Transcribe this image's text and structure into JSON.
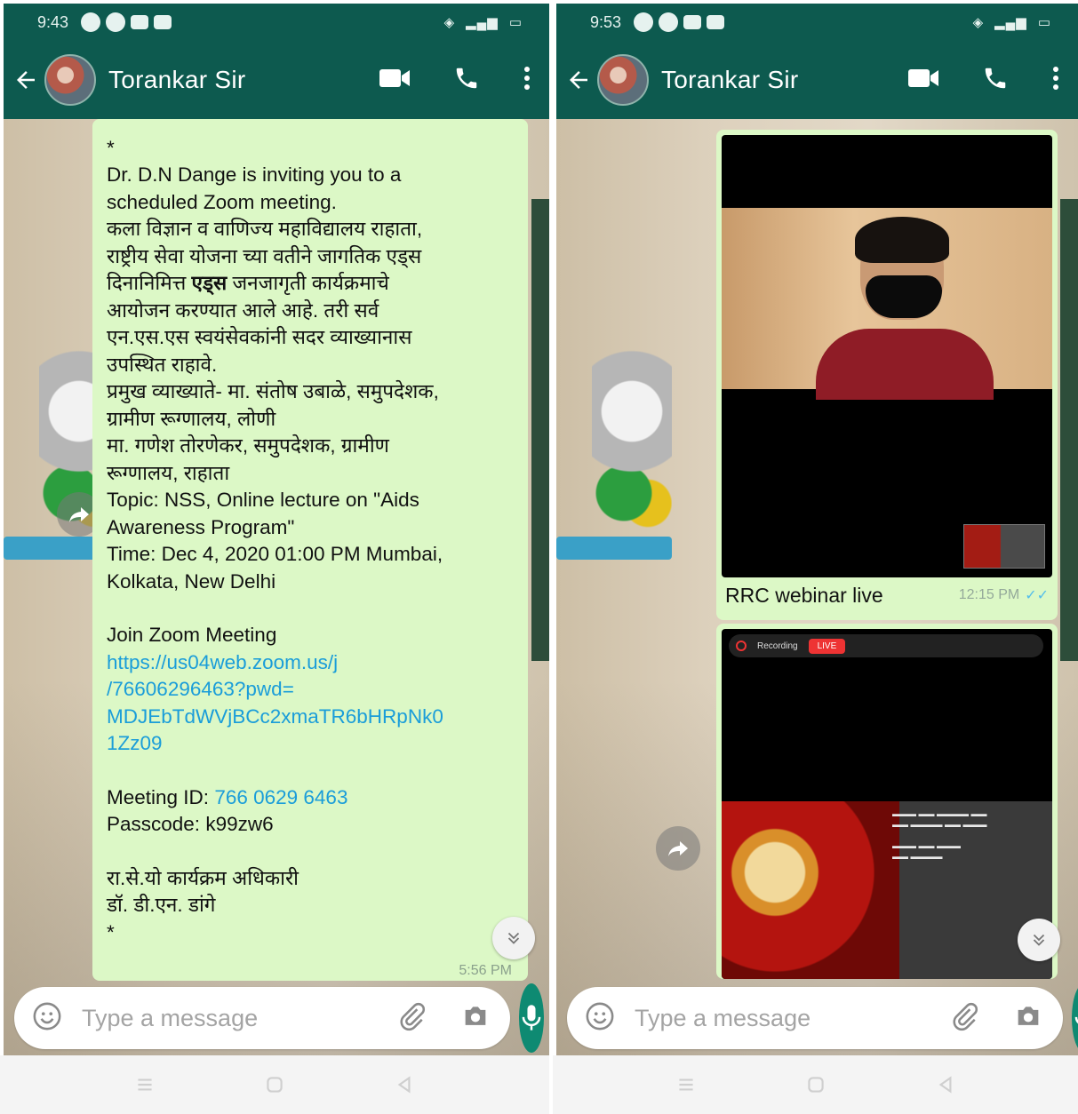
{
  "left": {
    "status": {
      "time": "9:43"
    },
    "header": {
      "name": "Torankar Sir"
    },
    "message": {
      "star_top": "*",
      "lines": [
        "Dr. D.N Dange is inviting you to a",
        "scheduled Zoom meeting.",
        "कला विज्ञान व वाणिज्य महाविद्यालय राहाता,",
        "राष्ट्रीय सेवा योजना च्या वतीने जागतिक एड्स",
        "दिनानिमित्त",
        "एड्स",
        "जनजागृती कार्यक्रमाचे",
        "आयोजन करण्यात आले आहे. तरी सर्व",
        "एन.एस.एस स्वयंसेवकांनी सदर व्याख्यानास",
        "उपस्थित राहावे.",
        "प्रमुख व्याख्याते- मा. संतोष उबाळे, समुपदेशक,",
        "ग्रामीण रूग्णालय, लोणी",
        "मा. गणेश तोरणेकर, समुपदेशक, ग्रामीण",
        "रूग्णालय,  राहाता",
        "Topic: NSS,  Online lecture on \"Aids",
        "Awareness Program\"",
        "Time: Dec 4, 2020 01:00 PM Mumbai,",
        "Kolkata, New Delhi"
      ],
      "join_label": "Join Zoom Meeting",
      "link_lines": [
        "https://us04web.zoom.us/j",
        "/76606296463?pwd=",
        "MDJEbTdWVjBCc2xmaTR6bHRpNk0",
        "1Zz09"
      ],
      "meeting_id_label": "Meeting ID: ",
      "meeting_id": "766 0629 6463",
      "passcode": "Passcode: k99zw6",
      "sign_1": "रा.से.यो कार्यक्रम अधिकारी",
      "sign_2": "डॉ. डी.एन. डांगे",
      "star_bottom": "*",
      "time": "5:56 PM"
    },
    "input": {
      "placeholder": "Type a message"
    }
  },
  "right": {
    "status": {
      "time": "9:53"
    },
    "header": {
      "name": "Torankar Sir"
    },
    "media_1": {
      "caption": "RRC webinar live",
      "time": "12:15 PM"
    },
    "media_2": {
      "rec_label": "Recording",
      "live_label": "LIVE"
    },
    "input": {
      "placeholder": "Type a message"
    }
  },
  "colors": {
    "header": "#0d5a4f",
    "bubble": "#dcf8c6",
    "link": "#1a9dd9",
    "mic": "#0e8a72"
  }
}
